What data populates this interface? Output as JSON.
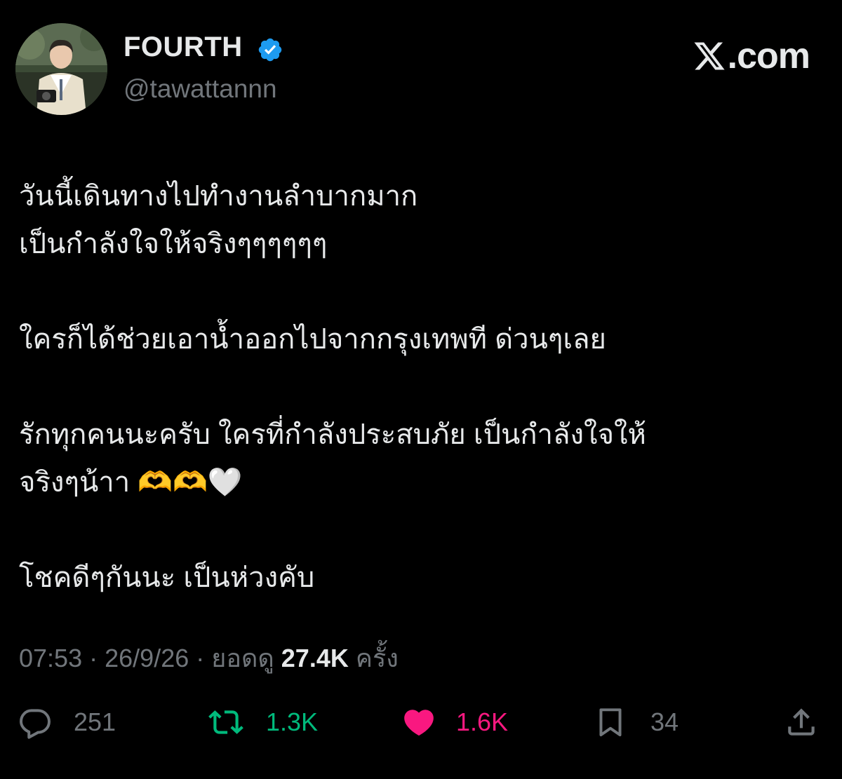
{
  "author": {
    "display_name": "FOURTH",
    "handle": "@tawattannn",
    "verified": true,
    "verified_color": "#1d9bf0"
  },
  "brand": {
    "label": ".com"
  },
  "tweet": {
    "paragraphs": [
      [
        "วันนี้เดินทางไปทำงานลำบากมาก",
        "เป็นกำลังใจให้จริงๆๆๆๆๆๆ"
      ],
      [
        "ใครก็ได้ช่วยเอาน้ำออกไปจากกรุงเทพที ด่วนๆเลย"
      ],
      [
        "รักทุกคนนะครับ ใครที่กำลังประสบภัย เป็นกำลังใจให้",
        "จริงๆน้าา 🫶🫶🤍"
      ],
      [
        "โชคดีๆกันนะ เป็นห่วงคับ"
      ]
    ]
  },
  "meta": {
    "time": "07:53",
    "date": "26/9/26",
    "views_label": "ยอดดู",
    "views_count": "27.4K",
    "views_suffix": "ครั้ง",
    "separator": "·"
  },
  "actions": {
    "reply": {
      "icon": "reply-icon",
      "count": "251"
    },
    "retweet": {
      "icon": "retweet-icon",
      "count": "1.3K",
      "color": "#00ba7c"
    },
    "like": {
      "icon": "heart-icon",
      "count": "1.6K",
      "color": "#f91880"
    },
    "bookmark": {
      "icon": "bookmark-icon",
      "count": "34"
    },
    "share": {
      "icon": "share-icon"
    }
  }
}
